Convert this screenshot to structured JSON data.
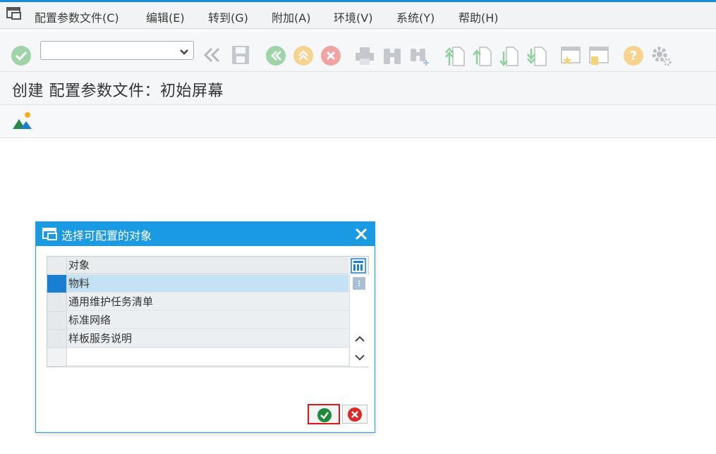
{
  "menubar": {
    "items": [
      {
        "label": "配置参数文件(C)"
      },
      {
        "label": "编辑(E)"
      },
      {
        "label": "转到(G)"
      },
      {
        "label": "附加(A)"
      },
      {
        "label": "环境(V)"
      },
      {
        "label": "系统(Y)"
      },
      {
        "label": "帮助(H)"
      }
    ]
  },
  "toolbar": {
    "command_value": ""
  },
  "page": {
    "title": "创建 配置参数文件：初始屏幕"
  },
  "dialog": {
    "title": "选择可配置的对象",
    "table": {
      "header": "对象",
      "rows": [
        "物料",
        "通用维护任务清单",
        "标准网络",
        "样板服务说明"
      ]
    }
  },
  "colors": {
    "accent": "#1b9ae4",
    "selected_row": "#c5e2f5",
    "highlight_border": "#e0161c"
  }
}
